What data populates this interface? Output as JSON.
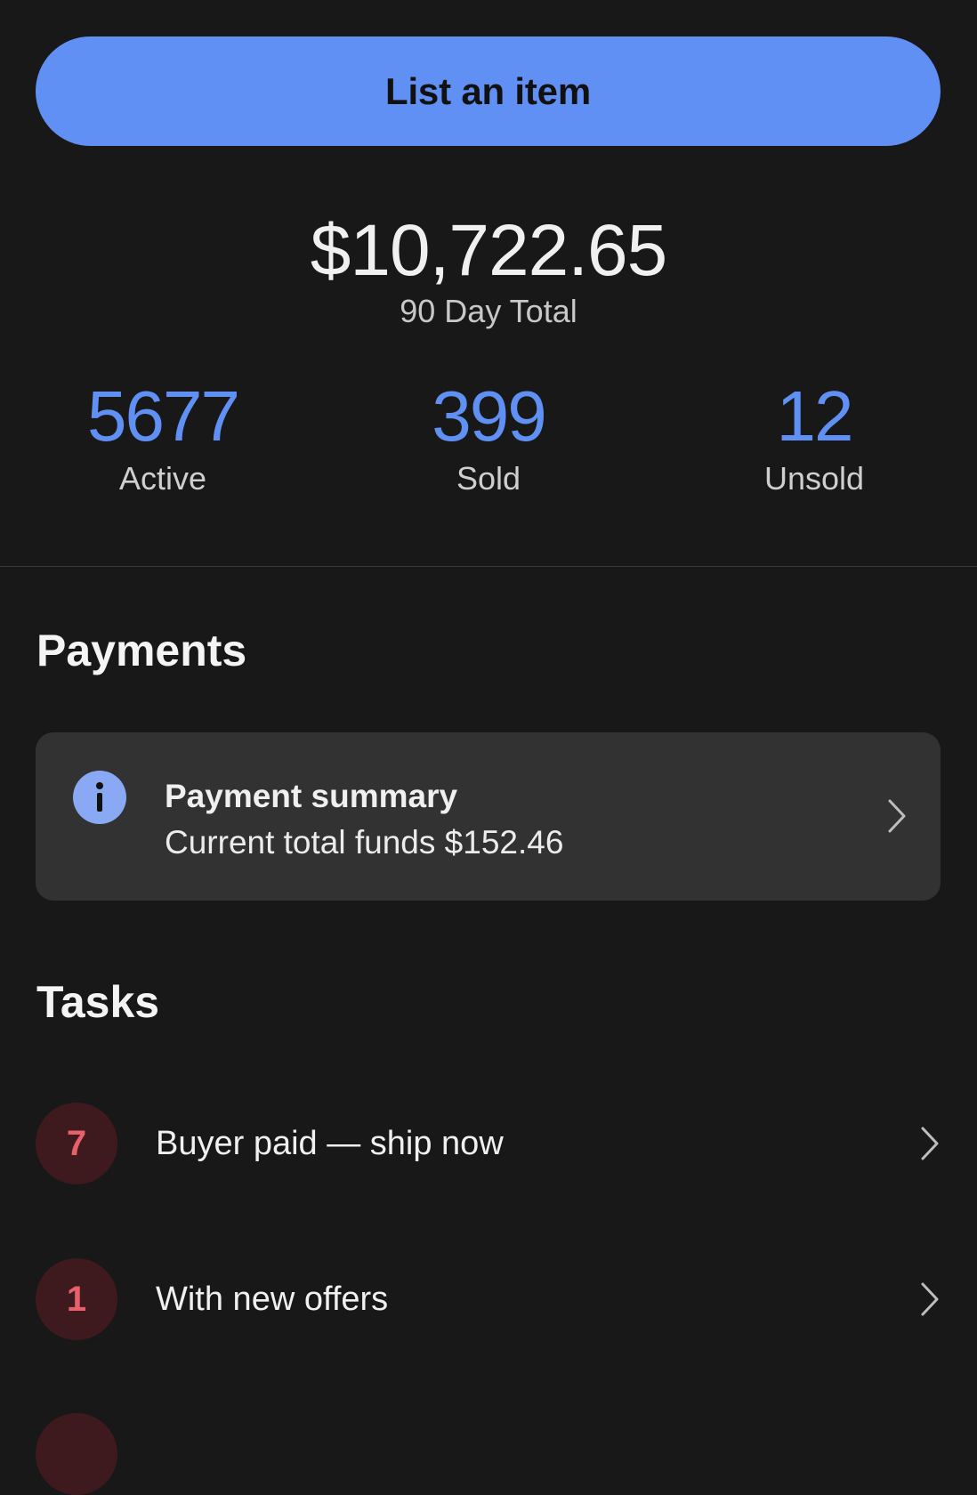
{
  "primary_action": {
    "label": "List an item",
    "color": "#6190f5"
  },
  "summary": {
    "total_amount": "$10,722.65",
    "total_label": "90 Day Total"
  },
  "stats": [
    {
      "value": "5677",
      "label": "Active"
    },
    {
      "value": "399",
      "label": "Sold"
    },
    {
      "value": "12",
      "label": "Unsold"
    }
  ],
  "payments": {
    "section_title": "Payments",
    "card": {
      "icon": "info-icon",
      "title": "Payment summary",
      "subtitle": "Current total funds $152.46"
    }
  },
  "tasks": {
    "section_title": "Tasks",
    "items": [
      {
        "count": "7",
        "label": "Buyer paid — ship now",
        "icon": "chevron-right-icon"
      },
      {
        "count": "1",
        "label": "With new offers",
        "icon": "chevron-right-icon"
      }
    ]
  },
  "colors": {
    "background": "#181818",
    "card": "#323232",
    "accent": "#6190f5",
    "badge_bg": "#3e1a1e",
    "badge_text": "#e8606a"
  }
}
